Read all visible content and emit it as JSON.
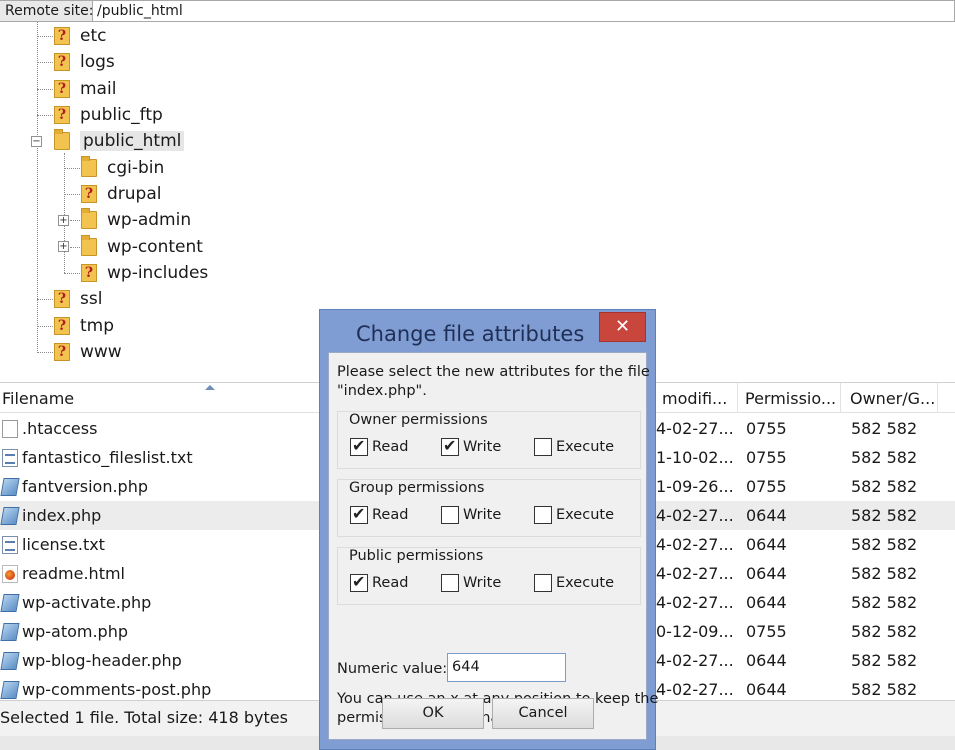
{
  "remote": {
    "label": "Remote site:",
    "path": "/public_html"
  },
  "tree": {
    "etc": "etc",
    "logs": "logs",
    "mail": "mail",
    "public_ftp": "public_ftp",
    "public_html": "public_html",
    "cgi_bin": "cgi-bin",
    "drupal": "drupal",
    "wp_admin": "wp-admin",
    "wp_content": "wp-content",
    "wp_includes": "wp-includes",
    "ssl": "ssl",
    "tmp": "tmp",
    "www": "www",
    "collapse_glyph": "−",
    "expand_glyph": "+"
  },
  "filelist": {
    "headers": {
      "filename": "Filename",
      "modified": "modifi...",
      "permissions": "Permissio...",
      "owner": "Owner/G..."
    },
    "rows": [
      {
        "name": ".htaccess",
        "modified": "4-02-27...",
        "perm": "0755",
        "owner": "582 582"
      },
      {
        "name": "fantastico_fileslist.txt",
        "modified": "1-10-02...",
        "perm": "0755",
        "owner": "582 582"
      },
      {
        "name": "fantversion.php",
        "modified": "1-09-26...",
        "perm": "0755",
        "owner": "582 582"
      },
      {
        "name": "index.php",
        "modified": "4-02-27...",
        "perm": "0644",
        "owner": "582 582"
      },
      {
        "name": "license.txt",
        "modified": "4-02-27...",
        "perm": "0644",
        "owner": "582 582"
      },
      {
        "name": "readme.html",
        "modified": "4-02-27...",
        "perm": "0644",
        "owner": "582 582"
      },
      {
        "name": "wp-activate.php",
        "modified": "4-02-27...",
        "perm": "0644",
        "owner": "582 582"
      },
      {
        "name": "wp-atom.php",
        "modified": "0-12-09...",
        "perm": "0755",
        "owner": "582 582"
      },
      {
        "name": "wp-blog-header.php",
        "modified": "4-02-27...",
        "perm": "0644",
        "owner": "582 582"
      },
      {
        "name": "wp-comments-post.php",
        "modified": "4-02-27...",
        "perm": "0644",
        "owner": "582 582"
      }
    ]
  },
  "status": {
    "text": "Selected 1 file. Total size: 418 bytes"
  },
  "dialog": {
    "title": "Change file attributes",
    "close_glyph": "✕",
    "intro_line1": "Please select the new attributes for the file",
    "intro_line2": "\"index.php\".",
    "owner_title": "Owner permissions",
    "group_title": "Group permissions",
    "public_title": "Public permissions",
    "read": "Read",
    "write": "Write",
    "execute": "Execute",
    "numeric_label": "Numeric value:",
    "numeric_value": "644",
    "hint_line1": "You can use an x at any position to keep the",
    "hint_line2": "permission the original files have.",
    "ok": "OK",
    "cancel": "Cancel"
  }
}
